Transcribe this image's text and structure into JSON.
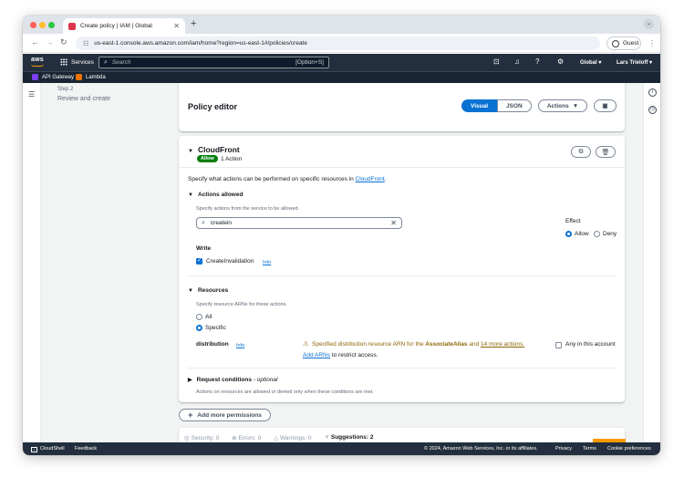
{
  "browser": {
    "tab_title": "Create policy | IAM | Global",
    "url": "us-east-1.console.aws.amazon.com/iam/home?region=us-east-1#/policies/create",
    "profile_label": "Guest"
  },
  "aws_header": {
    "logo": "aws",
    "services_label": "Services",
    "search_placeholder": "Search",
    "search_shortcut": "[Option+S]",
    "region_label": "Global",
    "account_label": "Lars Trieloff"
  },
  "favorites": [
    {
      "label": "API Gateway",
      "color": "#7a3ff2"
    },
    {
      "label": "Lambda",
      "color": "#ed7100"
    }
  ],
  "wizard": {
    "step_label": "Step 2",
    "step_title": "Review and create"
  },
  "policy_editor": {
    "title": "Policy editor",
    "visual_label": "Visual",
    "json_label": "JSON",
    "actions_label": "Actions"
  },
  "service_block": {
    "name": "CloudFront",
    "effect_badge": "Allow",
    "action_count": "1 Action",
    "description_prefix": "Specify what actions can be performed on specific resources in",
    "description_link": "CloudFront",
    "description_suffix": "."
  },
  "actions_allowed": {
    "heading": "Actions allowed",
    "hint": "Specify actions from the service to be allowed.",
    "search_value": "createin",
    "effect_label": "Effect",
    "effect_allow": "Allow",
    "effect_deny": "Deny",
    "group_label": "Write",
    "action_name": "CreateInvalidation",
    "info": "Info"
  },
  "resources": {
    "heading": "Resources",
    "hint": "Specify resource ARNs for these actions.",
    "option_all": "All",
    "option_specific": "Specific",
    "resource_name": "distribution",
    "info": "Info",
    "warning_prefix": "Specified distribution resource ARN for the",
    "warning_action": "AssociateAlias",
    "warning_middle": "and",
    "warning_link": "14 more actions.",
    "add_arns_link": "Add ARNs",
    "add_arns_suffix": "to restrict access.",
    "any_account_label": "Any in this account"
  },
  "request_conditions": {
    "heading": "Request conditions",
    "optional": "- optional",
    "hint": "Actions on resources are allowed or denied only when these conditions are met."
  },
  "add_permissions_label": "Add more permissions",
  "validation": {
    "security": "Security: 0",
    "errors": "Errors: 0",
    "warnings": "Warnings: 0",
    "suggestions": "Suggestions: 2"
  },
  "footer": {
    "cloudshell": "CloudShell",
    "feedback": "Feedback",
    "copyright": "© 2024, Amazon Web Services, Inc. or its affiliates.",
    "privacy": "Privacy",
    "terms": "Terms",
    "cookies": "Cookie preferences"
  },
  "colors": {
    "primary": "#0972d3",
    "aws_header": "#232f3e",
    "allow_green": "#037f0c",
    "warning": "#8d6605",
    "aws_orange": "#ff9900"
  }
}
